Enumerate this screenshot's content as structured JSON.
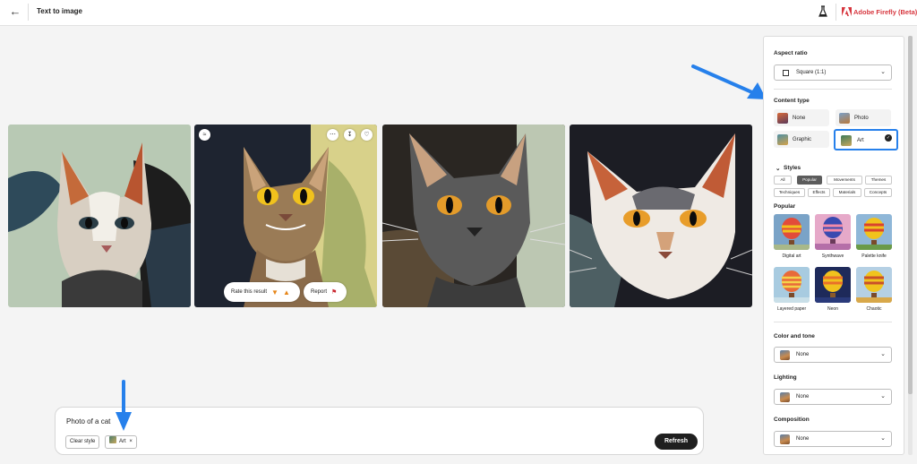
{
  "topbar": {
    "title": "Text to image",
    "brand": "Adobe Firefly (Beta)"
  },
  "gallery": {
    "images": [
      {
        "alt": "cat-1"
      },
      {
        "alt": "cat-2"
      },
      {
        "alt": "cat-3"
      },
      {
        "alt": "cat-4"
      }
    ],
    "rate_label": "Rate this result",
    "report_label": "Report"
  },
  "prompt": {
    "text": "Photo of a cat",
    "clear_style": "Clear style",
    "chip_art": "Art",
    "chip_close": "×",
    "refresh": "Refresh"
  },
  "panel": {
    "aspect_ratio": {
      "label": "Aspect ratio",
      "value": "Square (1:1)"
    },
    "content_type": {
      "label": "Content type",
      "options": [
        {
          "label": "None",
          "selected": false
        },
        {
          "label": "Photo",
          "selected": false
        },
        {
          "label": "Graphic",
          "selected": false
        },
        {
          "label": "Art",
          "selected": true
        }
      ]
    },
    "styles": {
      "label": "Styles",
      "tags": [
        "All",
        "Popular",
        "Movements",
        "Themes",
        "Techniques",
        "Effects",
        "Materials",
        "Concepts"
      ],
      "active_tag": "Popular",
      "section_label": "Popular",
      "items": [
        "Digital art",
        "Synthwave",
        "Palette knife",
        "Layered paper",
        "Neon",
        "Chaotic"
      ]
    },
    "color_tone": {
      "label": "Color and tone",
      "value": "None"
    },
    "lighting": {
      "label": "Lighting",
      "value": "None"
    },
    "composition": {
      "label": "Composition",
      "value": "None"
    },
    "accent_color": "#2680eb"
  }
}
